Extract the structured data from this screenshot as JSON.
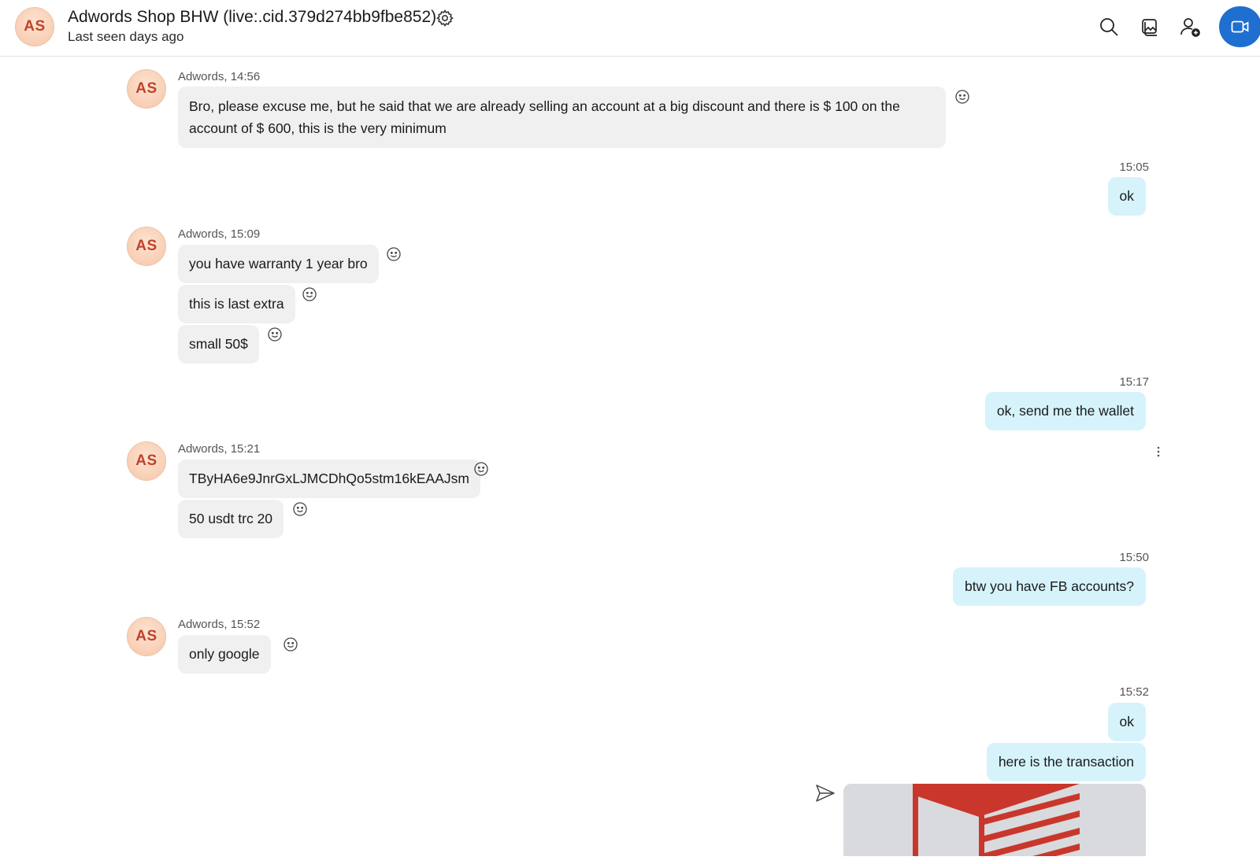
{
  "header": {
    "avatar_initials": "AS",
    "title": "Adwords Shop BHW (live:.cid.379d274bb9fbe852)",
    "subtitle": "Last seen days ago",
    "icons": [
      "gear-icon",
      "search-icon",
      "gallery-icon",
      "add-person-icon",
      "video-call-icon"
    ]
  },
  "messages": [
    {
      "dir": "in",
      "meta": "Adwords, 14:56",
      "text": "Bro, please excuse me, but he said that we are already selling an account at a big discount and there is $ 100 on the account of $ 600, this is the very minimum"
    },
    {
      "dir": "out",
      "meta": "15:05",
      "text": "ok"
    },
    {
      "dir": "in",
      "meta": "Adwords, 15:09",
      "text": "you have warranty 1 year bro"
    },
    {
      "dir": "in",
      "text": "this is last extra"
    },
    {
      "dir": "in",
      "text": "small 50$"
    },
    {
      "dir": "out",
      "meta": "15:17",
      "text": "ok, send me the wallet"
    },
    {
      "dir": "in",
      "meta": "Adwords, 15:21",
      "text": "TByHA6e9JnrGxLJMCDhQo5stm16kEAAJsm"
    },
    {
      "dir": "in",
      "text": "50 usdt trc 20"
    },
    {
      "dir": "out",
      "meta": "15:50",
      "text": "btw you have FB accounts?"
    },
    {
      "dir": "in",
      "meta": "Adwords, 15:52",
      "text": "only google"
    },
    {
      "dir": "out",
      "meta": "15:52",
      "text": "ok"
    },
    {
      "dir": "out",
      "text": "here is the transaction"
    }
  ],
  "colors": {
    "incoming_bubble": "#f0f0f0",
    "outgoing_bubble": "#d6f3fc",
    "avatar_text": "#c0432b",
    "video_button": "#1f6fd0",
    "attachment_accent": "#c9372c"
  }
}
